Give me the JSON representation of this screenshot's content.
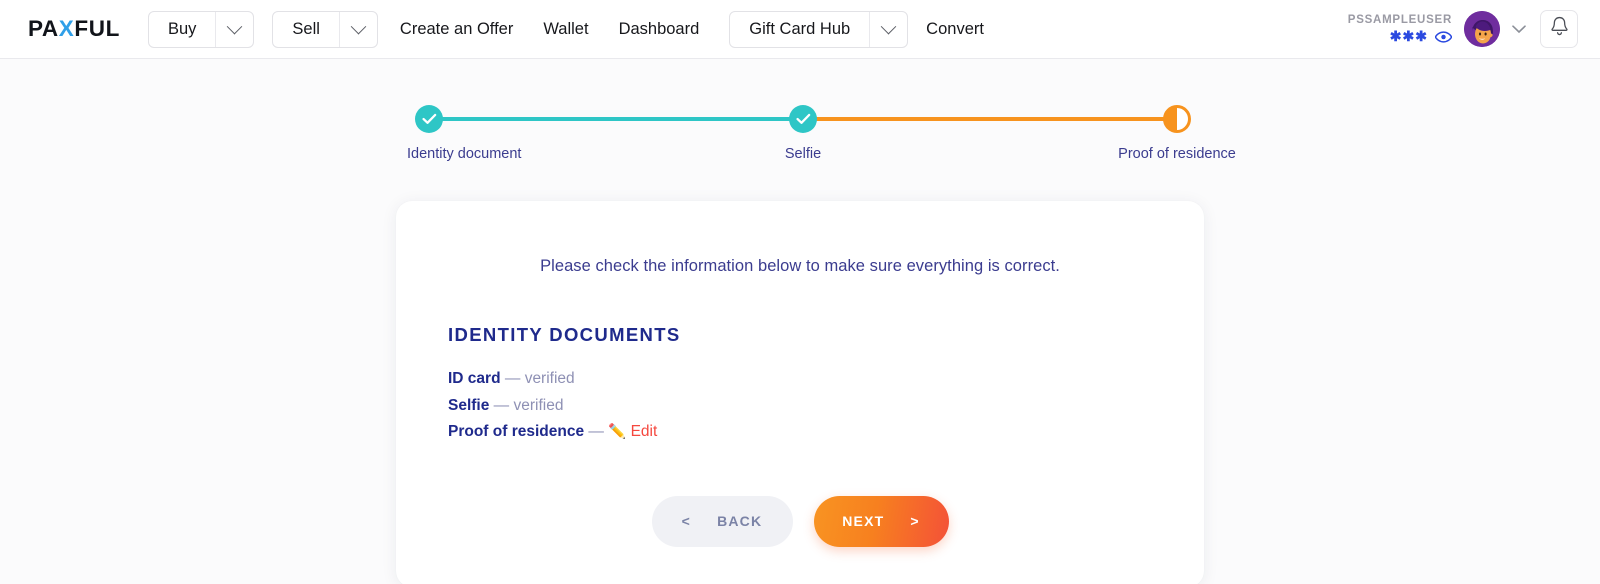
{
  "navbar": {
    "brand": {
      "pre": "PA",
      "x": "X",
      "post": "FUL"
    },
    "split_buttons": [
      {
        "label": "Buy",
        "caret_icon": "chevron-down-icon"
      },
      {
        "label": "Sell",
        "caret_icon": "chevron-down-icon"
      }
    ],
    "links": [
      "Create an Offer",
      "Wallet",
      "Dashboard"
    ],
    "gift_card": {
      "label": "Gift Card Hub",
      "caret_icon": "chevron-down-icon"
    },
    "convert_label": "Convert",
    "user": {
      "name": "PSSAMPLEUSER",
      "balance_masked": "✱✱✱",
      "eye_icon": "eye-icon",
      "avatar_icon": "user-avatar",
      "caret_icon": "chevron-down-icon"
    },
    "bell_icon": "bell-icon"
  },
  "stepper": {
    "steps": [
      {
        "label": "Identity document",
        "state": "complete"
      },
      {
        "label": "Selfie",
        "state": "complete"
      },
      {
        "label": "Proof of residence",
        "state": "in-progress"
      }
    ],
    "colors": {
      "complete": "#2ec6c6",
      "active": "#f7931e"
    }
  },
  "card": {
    "lead": "Please check the information below to make sure everything is correct.",
    "section_title": "Identity Documents",
    "documents": [
      {
        "name": "ID card",
        "separator": "—",
        "status": "verified",
        "action": null
      },
      {
        "name": "Selfie",
        "separator": "—",
        "status": "verified",
        "action": null
      },
      {
        "name": "Proof of residence",
        "separator": "—",
        "status": "",
        "action": "Edit",
        "action_icon": "pencil-icon"
      }
    ],
    "buttons": {
      "back": {
        "label": "Back",
        "arrow": "<"
      },
      "next": {
        "label": "Next",
        "arrow": ">"
      }
    }
  },
  "colors": {
    "brand_x": "#2f9fe8",
    "teal": "#2ec6c6",
    "orange": "#f7931e",
    "red": "#f5483f",
    "navy": "#1f2a8c",
    "indigo": "#3b3c8f",
    "muted": "#8e90b4"
  }
}
